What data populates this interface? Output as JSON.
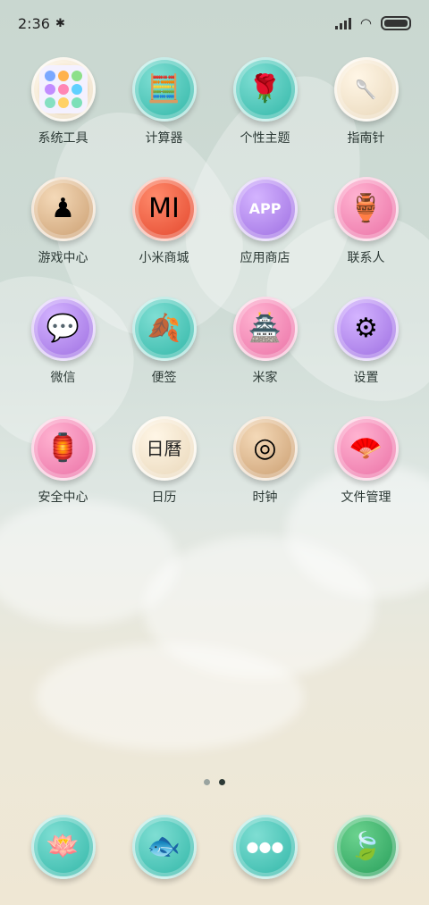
{
  "status_bar": {
    "time": "2:36",
    "bluetooth_icon": "bluetooth-icon",
    "signal_icon": "signal-icon",
    "wifi_icon": "wifi-icon",
    "battery_icon": "battery-icon"
  },
  "apps": [
    {
      "label": "系统工具",
      "icon": "system-tools-folder-icon",
      "glyph": "",
      "style": "folder"
    },
    {
      "label": "计算器",
      "icon": "abacus-icon",
      "glyph": "🧮",
      "style": "teal"
    },
    {
      "label": "个性主题",
      "icon": "paper-cut-theme-icon",
      "glyph": "🌹",
      "style": "teal"
    },
    {
      "label": "指南针",
      "icon": "spoon-compass-icon",
      "glyph": "🥄",
      "style": "cream"
    },
    {
      "label": "游戏中心",
      "icon": "chess-board-icon",
      "glyph": "♟",
      "style": "wood"
    },
    {
      "label": "小米商城",
      "icon": "mi-logo-icon",
      "glyph": "MI",
      "style": "red"
    },
    {
      "label": "应用商店",
      "icon": "app-store-bag-icon",
      "glyph": "APP",
      "style": "purple"
    },
    {
      "label": "联系人",
      "icon": "gourd-contacts-icon",
      "glyph": "🏺",
      "style": "pink"
    },
    {
      "label": "微信",
      "icon": "wechat-icon",
      "glyph": "💬",
      "style": "purple"
    },
    {
      "label": "便签",
      "icon": "ginkgo-leaf-icon",
      "glyph": "🍂",
      "style": "teal"
    },
    {
      "label": "米家",
      "icon": "house-roof-icon",
      "glyph": "🏯",
      "style": "pink"
    },
    {
      "label": "设置",
      "icon": "jade-disc-settings-icon",
      "glyph": "⚙",
      "style": "purple"
    },
    {
      "label": "安全中心",
      "icon": "shield-lantern-icon",
      "glyph": "🏮",
      "style": "pink"
    },
    {
      "label": "日历",
      "icon": "calendar-scroll-icon",
      "glyph": "日曆",
      "style": "cream"
    },
    {
      "label": "时钟",
      "icon": "tree-ring-clock-icon",
      "glyph": "◎",
      "style": "wood"
    },
    {
      "label": "文件管理",
      "icon": "folding-fan-icon",
      "glyph": "🪭",
      "style": "pink"
    }
  ],
  "folder_tiles": [
    "#7aa8ff",
    "#ffb24d",
    "#8de08a",
    "#c28cff",
    "#ff86b4",
    "#5fd0ff",
    "#86e0c2",
    "#ffd166",
    "#7ce0b8"
  ],
  "page_indicator": {
    "pages": 2,
    "active": 2
  },
  "dock": [
    {
      "icon": "lotus-flower-icon",
      "glyph": "🪷",
      "style": "teal"
    },
    {
      "icon": "koi-fish-icon",
      "glyph": "🐟",
      "style": "teal"
    },
    {
      "icon": "three-dots-messages-icon",
      "glyph": "●●●",
      "style": "teal"
    },
    {
      "icon": "lotus-leaf-camera-icon",
      "glyph": "🍃",
      "style": "green"
    }
  ]
}
